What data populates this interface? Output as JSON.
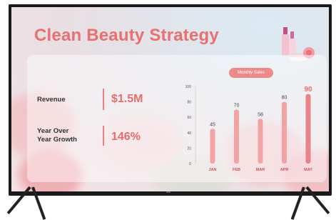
{
  "slide": {
    "title": "Clean Beauty Strategy"
  },
  "metrics": [
    {
      "label": "Revenue",
      "value": "$1.5M"
    },
    {
      "label_line1": "Year Over",
      "label_line2": "Year Growth",
      "value": "146%"
    }
  ],
  "chart_badge": "Monthly Sales",
  "chart_data": {
    "type": "bar",
    "categories": [
      "JAN",
      "FEB",
      "MAR",
      "APR",
      "MAY"
    ],
    "values": [
      45,
      70,
      58,
      80,
      90
    ],
    "ylim": [
      0,
      100
    ],
    "yticks": [
      0,
      20,
      40,
      60,
      80,
      100
    ],
    "title": "Monthly Sales"
  },
  "colors": {
    "accent": "#ea6f6f",
    "bar": "#f2a3a3"
  }
}
